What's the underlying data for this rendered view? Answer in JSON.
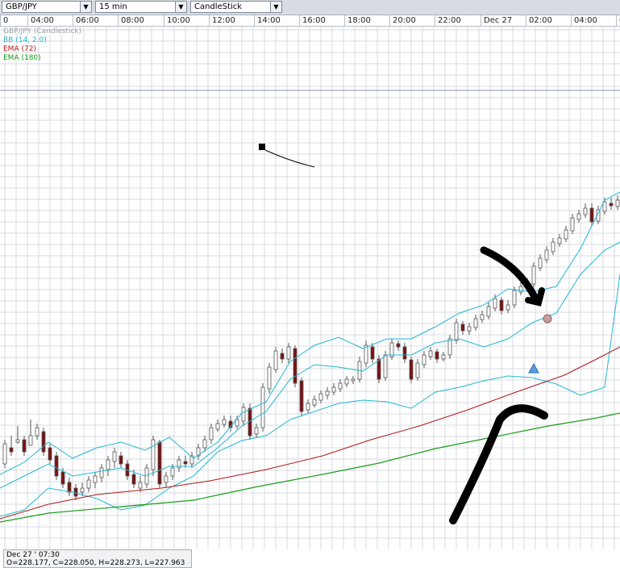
{
  "toolbar": {
    "symbol": "GBP/JPY",
    "interval": "15 min",
    "chart_type": "CandleStick"
  },
  "time_axis": [
    "0",
    "04:00",
    "06:00",
    "08:00",
    "10:00",
    "12:00",
    "14:00",
    "16:00",
    "18:00",
    "20:00",
    "22:00",
    "Dec 27",
    "02:00",
    "04:00",
    "0"
  ],
  "legend": {
    "series": "GBP/JPY (Candlestick)",
    "bb": "BB (14, 2.0)",
    "ema72": "EMA (72)",
    "ema180": "EMA (180)"
  },
  "colors": {
    "series": "#9aa0a8",
    "bb": "#22b8d0",
    "ema72": "#b01818",
    "ema180": "#1a9c1a",
    "bull": "#ffffff",
    "bear": "#7a1010",
    "grid": "#d7dbe0"
  },
  "status": {
    "datetime": "Dec 27 ' 07:30",
    "ohlc": "O=228.177, C=228.050, H=228.273, L=227.963"
  },
  "chart_data": {
    "type": "candlestick",
    "symbol": "GBP/JPY",
    "interval": "15 min",
    "xlabels": [
      "0",
      "04:00",
      "06:00",
      "08:00",
      "10:00",
      "12:00",
      "14:00",
      "16:00",
      "18:00",
      "20:00",
      "22:00",
      "Dec 27",
      "02:00",
      "04:00",
      "0"
    ],
    "ylabel": "",
    "bollinger": {
      "period": 14,
      "stddev": 2.0
    },
    "ema": [
      72,
      180
    ],
    "ohlc": [
      [
        0,
        550,
        575,
        545,
        580,
        "bull"
      ],
      [
        1,
        555,
        560,
        540,
        565,
        "bear"
      ],
      [
        2,
        548,
        545,
        528,
        550,
        "bull"
      ],
      [
        3,
        545,
        560,
        540,
        565,
        "bear"
      ],
      [
        4,
        552,
        540,
        520,
        545,
        "bull"
      ],
      [
        5,
        540,
        530,
        525,
        545,
        "bull"
      ],
      [
        6,
        535,
        560,
        530,
        565,
        "bear"
      ],
      [
        7,
        555,
        570,
        550,
        575,
        "bear"
      ],
      [
        8,
        565,
        590,
        560,
        595,
        "bear"
      ],
      [
        9,
        585,
        600,
        580,
        605,
        "bear"
      ],
      [
        10,
        598,
        610,
        592,
        615,
        "bear"
      ],
      [
        11,
        605,
        615,
        600,
        620,
        "bear"
      ],
      [
        12,
        610,
        605,
        598,
        615,
        "bull"
      ],
      [
        13,
        605,
        595,
        590,
        610,
        "bull"
      ],
      [
        14,
        598,
        590,
        585,
        605,
        "bull"
      ],
      [
        15,
        592,
        580,
        575,
        598,
        "bull"
      ],
      [
        16,
        582,
        570,
        565,
        590,
        "bull"
      ],
      [
        17,
        572,
        560,
        555,
        580,
        "bull"
      ],
      [
        18,
        565,
        575,
        560,
        580,
        "bear"
      ],
      [
        19,
        575,
        590,
        570,
        595,
        "bear"
      ],
      [
        20,
        588,
        600,
        582,
        605,
        "bear"
      ],
      [
        21,
        598,
        605,
        590,
        610,
        "bull"
      ],
      [
        22,
        600,
        580,
        575,
        605,
        "bull"
      ],
      [
        23,
        582,
        545,
        540,
        590,
        "bull"
      ],
      [
        24,
        548,
        600,
        545,
        605,
        "bear"
      ],
      [
        25,
        598,
        590,
        585,
        605,
        "bull"
      ],
      [
        26,
        590,
        580,
        575,
        595,
        "bull"
      ],
      [
        27,
        580,
        570,
        565,
        585,
        "bull"
      ],
      [
        28,
        572,
        575,
        565,
        580,
        "bear"
      ],
      [
        29,
        575,
        565,
        560,
        580,
        "bull"
      ],
      [
        30,
        565,
        555,
        550,
        570,
        "bull"
      ],
      [
        31,
        555,
        545,
        540,
        560,
        "bull"
      ],
      [
        32,
        545,
        530,
        525,
        550,
        "bull"
      ],
      [
        33,
        532,
        525,
        520,
        535,
        "bull"
      ],
      [
        34,
        526,
        520,
        515,
        530,
        "bull"
      ],
      [
        35,
        522,
        530,
        515,
        535,
        "bear"
      ],
      [
        36,
        528,
        520,
        515,
        532,
        "bull"
      ],
      [
        37,
        522,
        505,
        500,
        528,
        "bull"
      ],
      [
        38,
        506,
        540,
        500,
        545,
        "bear"
      ],
      [
        39,
        538,
        530,
        525,
        542,
        "bull"
      ],
      [
        40,
        530,
        480,
        475,
        535,
        "bull"
      ],
      [
        41,
        482,
        455,
        450,
        488,
        "bull"
      ],
      [
        42,
        458,
        435,
        430,
        462,
        "bull"
      ],
      [
        43,
        438,
        445,
        432,
        450,
        "bear"
      ],
      [
        44,
        445,
        430,
        425,
        450,
        "bull"
      ],
      [
        45,
        432,
        475,
        428,
        480,
        "bear"
      ],
      [
        46,
        472,
        510,
        468,
        515,
        "bear"
      ],
      [
        47,
        508,
        500,
        495,
        512,
        "bull"
      ],
      [
        48,
        502,
        495,
        490,
        505,
        "bull"
      ],
      [
        49,
        496,
        488,
        484,
        500,
        "bull"
      ],
      [
        50,
        490,
        485,
        480,
        495,
        "bull"
      ],
      [
        51,
        486,
        480,
        475,
        490,
        "bull"
      ],
      [
        52,
        482,
        475,
        470,
        486,
        "bull"
      ],
      [
        53,
        476,
        470,
        466,
        480,
        "bull"
      ],
      [
        54,
        472,
        470,
        466,
        476,
        "bull"
      ],
      [
        55,
        470,
        448,
        442,
        474,
        "bull"
      ],
      [
        56,
        450,
        428,
        422,
        455,
        "bull"
      ],
      [
        57,
        430,
        445,
        425,
        450,
        "bear"
      ],
      [
        58,
        445,
        470,
        440,
        475,
        "bear"
      ],
      [
        59,
        468,
        440,
        435,
        472,
        "bull"
      ],
      [
        60,
        442,
        425,
        420,
        446,
        "bull"
      ],
      [
        61,
        426,
        430,
        422,
        435,
        "bear"
      ],
      [
        62,
        430,
        445,
        425,
        450,
        "bear"
      ],
      [
        63,
        446,
        470,
        442,
        475,
        "bear"
      ],
      [
        64,
        468,
        450,
        445,
        472,
        "bull"
      ],
      [
        65,
        452,
        440,
        435,
        456,
        "bull"
      ],
      [
        66,
        442,
        435,
        430,
        446,
        "bull"
      ],
      [
        67,
        436,
        445,
        432,
        450,
        "bear"
      ],
      [
        68,
        445,
        440,
        436,
        448,
        "bull"
      ],
      [
        69,
        440,
        420,
        415,
        445,
        "bull"
      ],
      [
        70,
        422,
        400,
        395,
        426,
        "bull"
      ],
      [
        71,
        402,
        410,
        398,
        415,
        "bear"
      ],
      [
        72,
        410,
        405,
        400,
        415,
        "bull"
      ],
      [
        73,
        406,
        395,
        390,
        410,
        "bull"
      ],
      [
        74,
        396,
        390,
        385,
        400,
        "bull"
      ],
      [
        75,
        392,
        380,
        375,
        396,
        "bull"
      ],
      [
        76,
        382,
        370,
        365,
        386,
        "bull"
      ],
      [
        77,
        372,
        385,
        368,
        390,
        "bear"
      ],
      [
        78,
        384,
        378,
        372,
        388,
        "bull"
      ],
      [
        79,
        378,
        360,
        355,
        382,
        "bull"
      ],
      [
        80,
        362,
        355,
        350,
        366,
        "bull"
      ],
      [
        81,
        356,
        350,
        345,
        360,
        "bull"
      ],
      [
        82,
        352,
        330,
        325,
        356,
        "bull"
      ],
      [
        83,
        332,
        320,
        315,
        336,
        "bull"
      ],
      [
        84,
        322,
        310,
        305,
        326,
        "bull"
      ],
      [
        85,
        312,
        300,
        295,
        316,
        "bull"
      ],
      [
        86,
        302,
        295,
        290,
        306,
        "bull"
      ],
      [
        87,
        296,
        285,
        280,
        300,
        "bull"
      ],
      [
        88,
        286,
        270,
        265,
        290,
        "bull"
      ],
      [
        89,
        272,
        265,
        260,
        276,
        "bull"
      ],
      [
        90,
        266,
        258,
        252,
        270,
        "bull"
      ],
      [
        91,
        258,
        275,
        252,
        280,
        "bear"
      ],
      [
        92,
        274,
        260,
        255,
        278,
        "bull"
      ],
      [
        93,
        262,
        250,
        245,
        266,
        "bull"
      ],
      [
        94,
        252,
        255,
        245,
        260,
        "bear"
      ],
      [
        95,
        256,
        248,
        242,
        260,
        "bull"
      ]
    ]
  }
}
